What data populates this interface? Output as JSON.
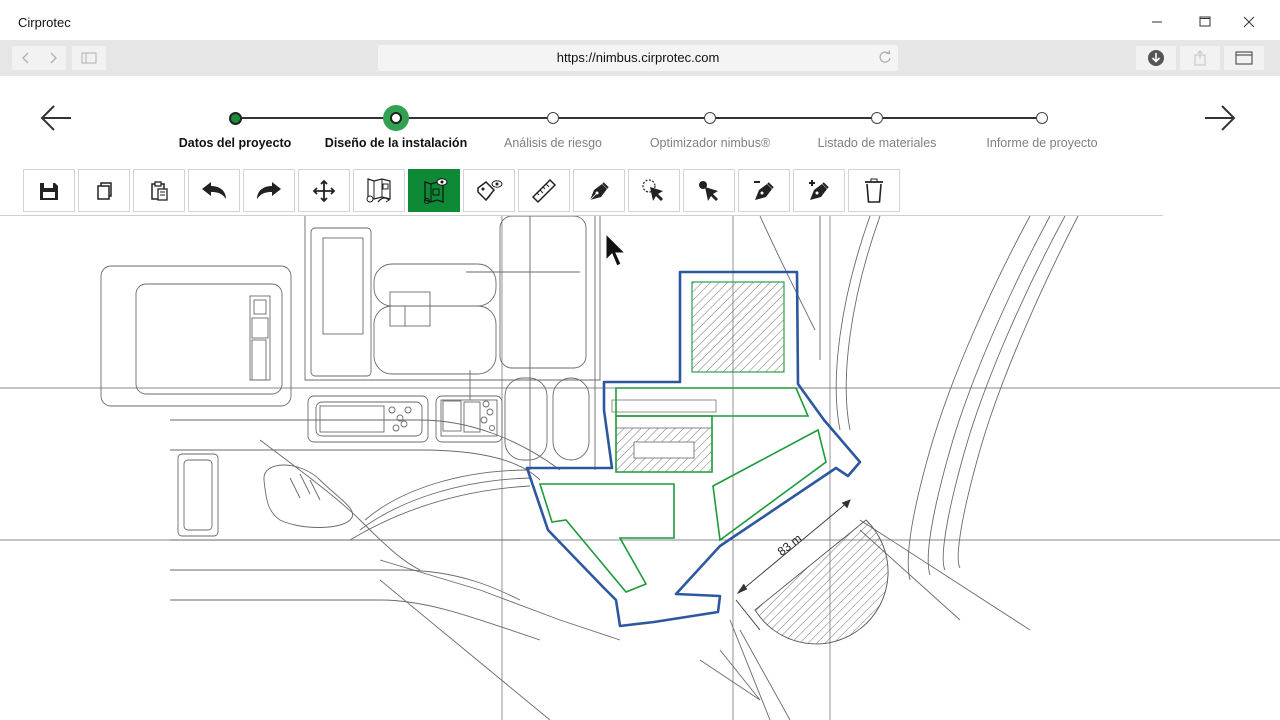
{
  "window": {
    "title": "Cirprotec"
  },
  "browser": {
    "url": "https://nimbus.cirprotec.com"
  },
  "stepper": {
    "steps": [
      {
        "label": "Datos del proyecto",
        "state": "done"
      },
      {
        "label": "Diseño de la instalación",
        "state": "active"
      },
      {
        "label": "Análisis de riesgo",
        "state": "pending"
      },
      {
        "label": "Optimizador nimbus®",
        "state": "pending"
      },
      {
        "label": "Listado de materiales",
        "state": "pending"
      },
      {
        "label": "Informe de proyecto",
        "state": "pending"
      }
    ]
  },
  "toolbar": {
    "tools": [
      {
        "icon": "save-icon"
      },
      {
        "icon": "copy-icon"
      },
      {
        "icon": "paste-icon"
      },
      {
        "icon": "undo-icon"
      },
      {
        "icon": "redo-icon"
      },
      {
        "icon": "move-icon"
      },
      {
        "icon": "import-plan-icon"
      },
      {
        "icon": "view-plan-icon",
        "active": true
      },
      {
        "icon": "tag-view-icon"
      },
      {
        "icon": "ruler-icon"
      },
      {
        "icon": "pen-icon"
      },
      {
        "icon": "select-area-icon"
      },
      {
        "icon": "select-point-icon"
      },
      {
        "icon": "pen-remove-icon"
      },
      {
        "icon": "pen-add-icon"
      },
      {
        "icon": "trash-icon"
      }
    ]
  },
  "canvas": {
    "dimension_label": "83 m"
  },
  "colors": {
    "accent": "#0e8a37",
    "outline": "#2d58a0",
    "zone": "#1f9a3a"
  }
}
